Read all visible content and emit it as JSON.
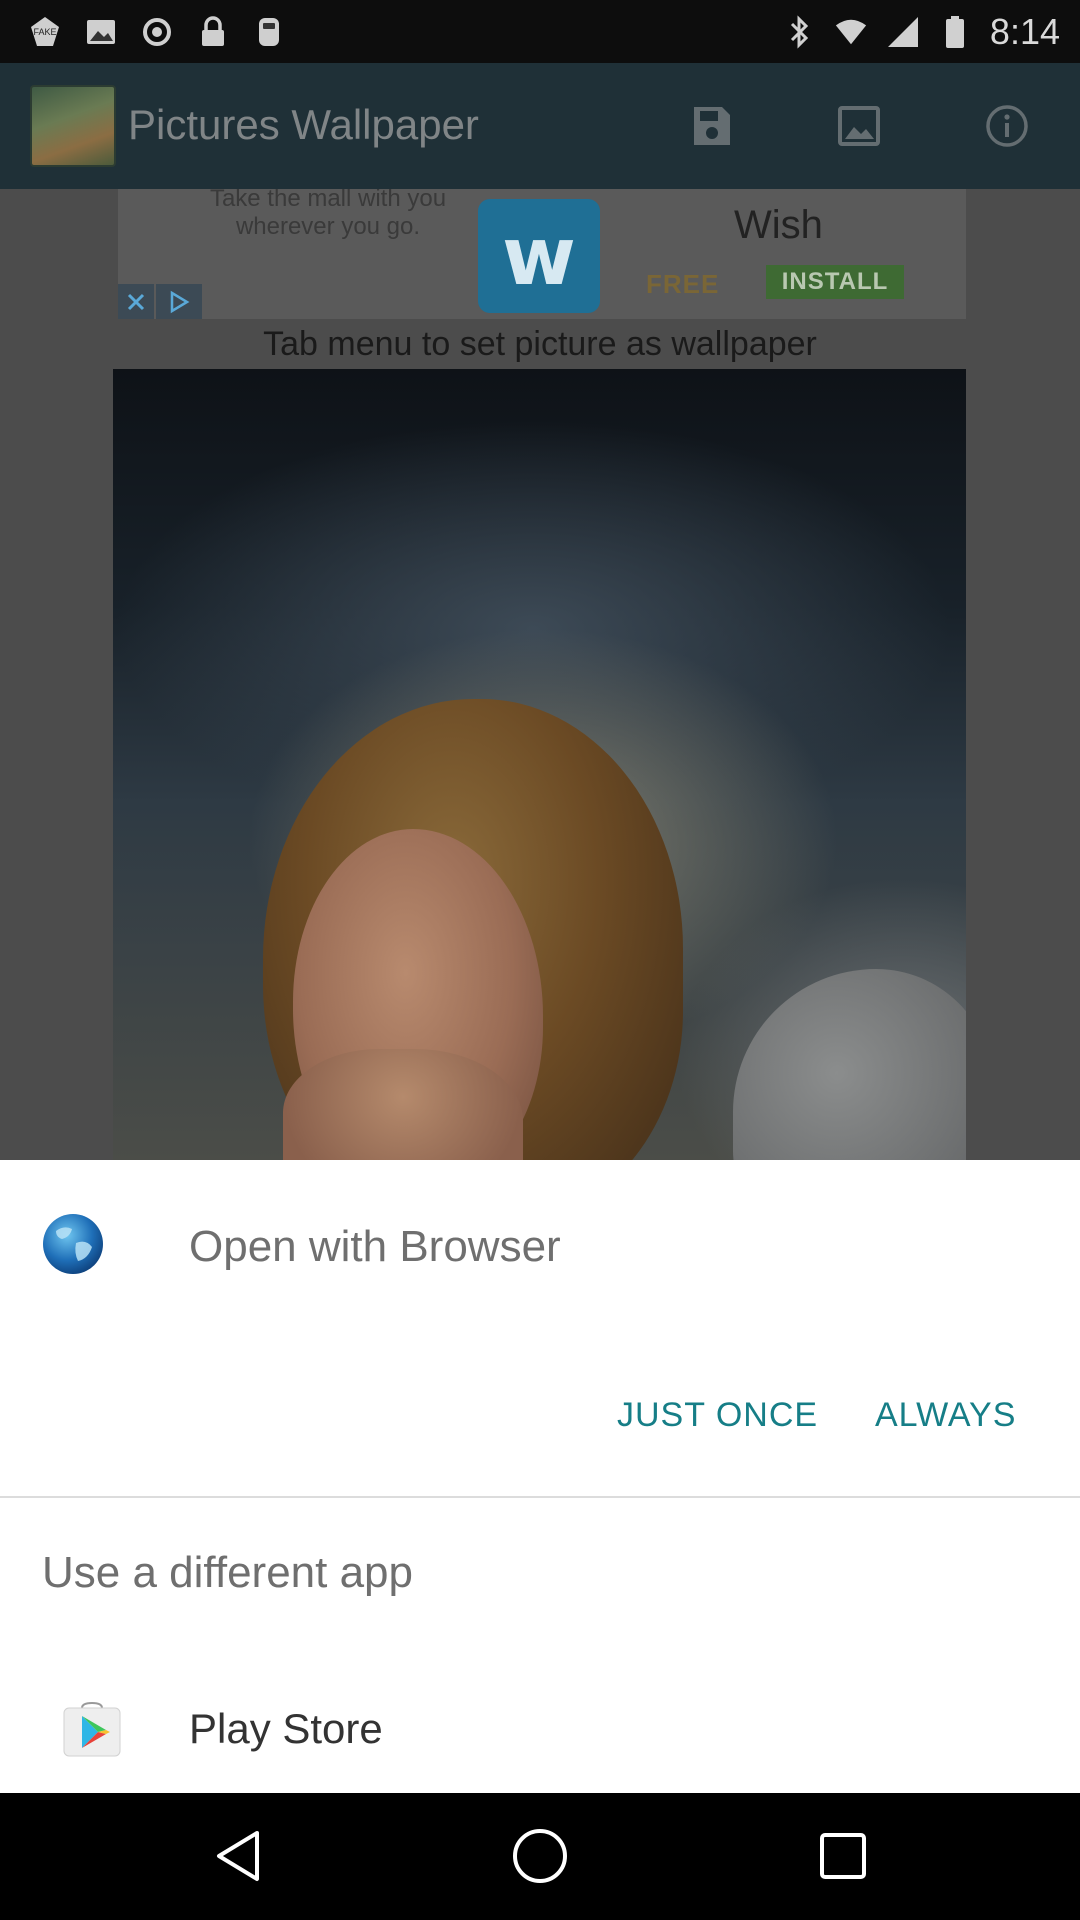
{
  "status_bar": {
    "time": "8:14",
    "left_icons": [
      "fake-gps-icon",
      "photo-icon",
      "sync-icon",
      "lock-icon",
      "game-controller-icon"
    ],
    "right_icons": [
      "bluetooth-icon",
      "wifi-icon",
      "signal-icon",
      "battery-icon"
    ]
  },
  "app_bar": {
    "title": "Pictures Wallpaper",
    "actions": [
      "save-icon",
      "image-icon",
      "info-icon"
    ]
  },
  "ad": {
    "caption": "Take the mall with you wherever you go.",
    "logo_letter": "w",
    "brand": "Wish",
    "price": "FREE",
    "cta": "INSTALL"
  },
  "hint": "Tab menu to set picture as wallpaper",
  "chooser": {
    "title": "Open with Browser",
    "just_once": "JUST ONCE",
    "always": "ALWAYS",
    "alt_title": "Use a different app",
    "apps": [
      {
        "label": "Play Store",
        "icon": "play-store-icon"
      }
    ]
  },
  "nav": [
    "back-icon",
    "home-icon",
    "recents-icon"
  ],
  "colors": {
    "accent": "#167e87",
    "sheet_bg": "#ffffff",
    "title_text": "#6f6f6f"
  }
}
